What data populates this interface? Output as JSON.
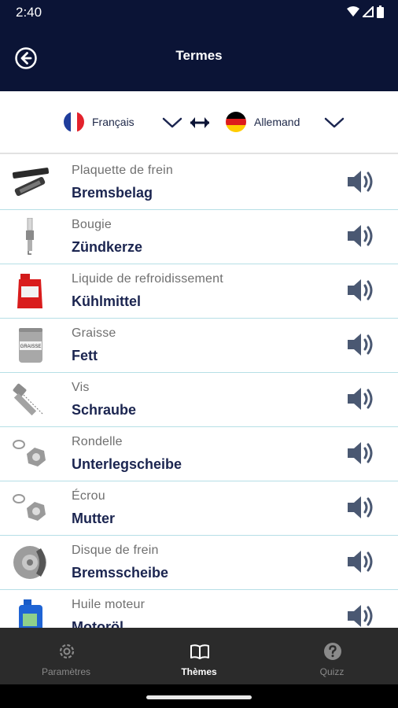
{
  "status": {
    "time": "2:40"
  },
  "header": {
    "title": "Termes"
  },
  "languages": {
    "source": "Français",
    "target": "Allemand"
  },
  "terms": [
    {
      "source": "Plaquette de frein",
      "target": "Bremsbelag",
      "image": "brake-pad"
    },
    {
      "source": "Bougie",
      "target": "Zündkerze",
      "image": "spark-plug"
    },
    {
      "source": "Liquide de refroidissement",
      "target": "Kühlmittel",
      "image": "coolant"
    },
    {
      "source": "Graisse",
      "target": "Fett",
      "image": "grease"
    },
    {
      "source": "Vis",
      "target": "Schraube",
      "image": "screw"
    },
    {
      "source": "Rondelle",
      "target": "Unterlegscheibe",
      "image": "washer"
    },
    {
      "source": "Écrou",
      "target": "Mutter",
      "image": "nut"
    },
    {
      "source": "Disque de frein",
      "target": "Bremsscheibe",
      "image": "brake-disc"
    },
    {
      "source": "Huile moteur",
      "target": "Motoröl",
      "image": "engine-oil"
    }
  ],
  "grease_label": "GRAISSE",
  "nav": {
    "settings": "Paramètres",
    "themes": "Thèmes",
    "quiz": "Quizz"
  },
  "colors": {
    "header": "#0b1436",
    "term_text": "#1b2550",
    "divider": "#b6dfe6",
    "nav_bg": "#2b2b2b"
  }
}
